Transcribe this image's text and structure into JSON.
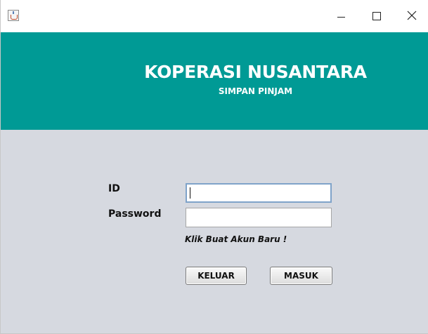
{
  "window": {
    "icon": "java-icon",
    "controls": {
      "minimize": "minimize-icon",
      "maximize": "maximize-icon",
      "close": "close-icon"
    }
  },
  "header": {
    "title": "KOPERASI NUSANTARA",
    "subtitle": "SIMPAN PINJAM",
    "background": "#009a95"
  },
  "form": {
    "id_label": "ID",
    "id_value": "",
    "password_label": "Password",
    "password_value": "",
    "hint": "Klik Buat Akun Baru !",
    "background": "#d6d9e0"
  },
  "buttons": {
    "keluar": "KELUAR",
    "masuk": "MASUK"
  }
}
